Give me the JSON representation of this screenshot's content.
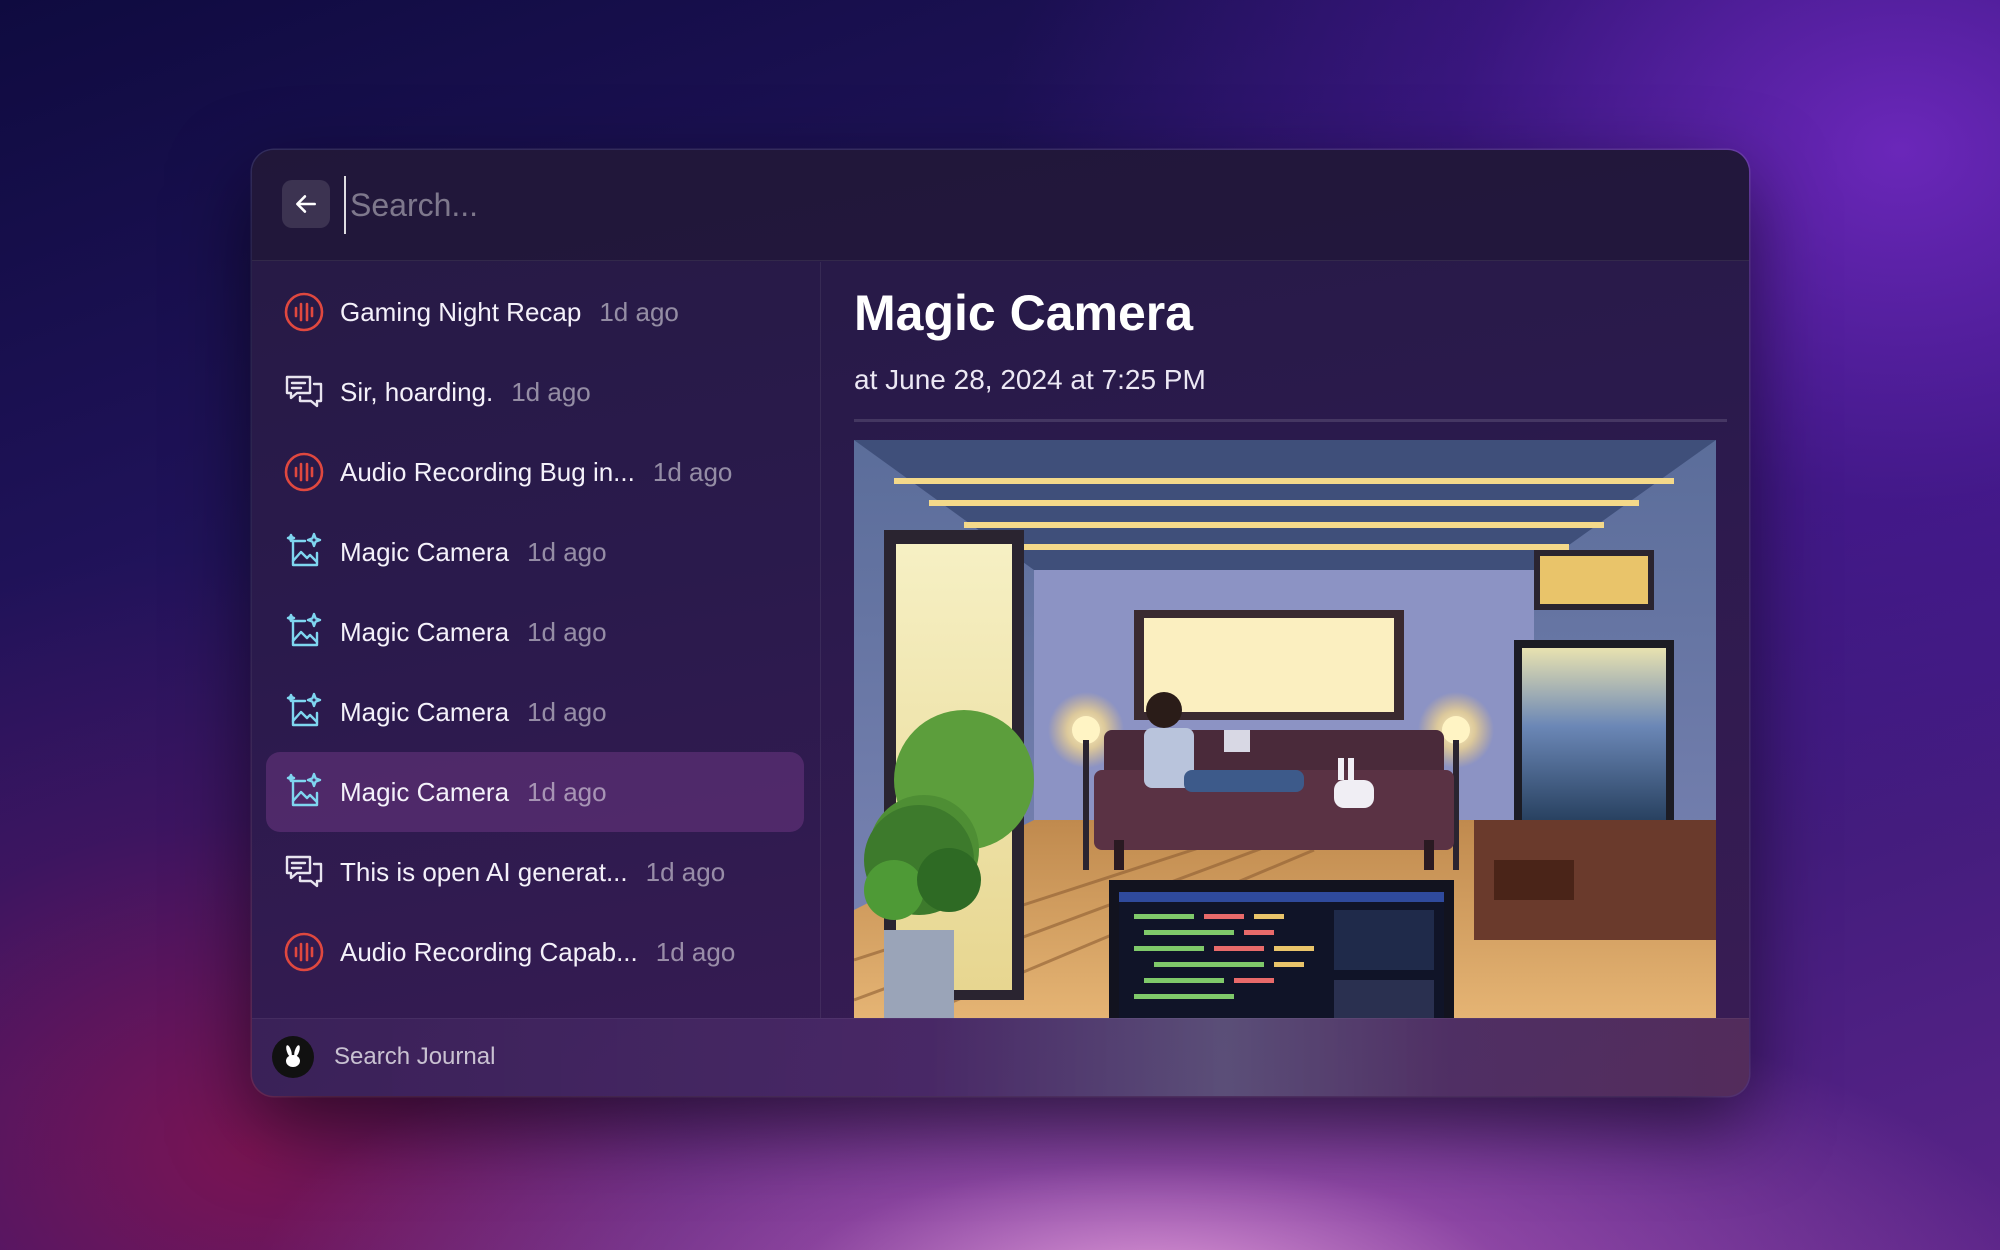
{
  "search": {
    "placeholder": "Search...",
    "value": ""
  },
  "list": {
    "items": [
      {
        "title": "Gaming Night Recap",
        "time": "1d ago",
        "icon": "audio-recording-icon",
        "selected": false
      },
      {
        "title": "Sir, hoarding.",
        "time": "1d ago",
        "icon": "chat-bubbles-icon",
        "selected": false
      },
      {
        "title": "Audio Recording Bug in...",
        "time": "1d ago",
        "icon": "audio-recording-icon",
        "selected": false
      },
      {
        "title": "Magic Camera",
        "time": "1d ago",
        "icon": "magic-image-icon",
        "selected": false
      },
      {
        "title": "Magic Camera",
        "time": "1d ago",
        "icon": "magic-image-icon",
        "selected": false
      },
      {
        "title": "Magic Camera",
        "time": "1d ago",
        "icon": "magic-image-icon",
        "selected": false
      },
      {
        "title": "Magic Camera",
        "time": "1d ago",
        "icon": "magic-image-icon",
        "selected": true
      },
      {
        "title": "This is open AI generat...",
        "time": "1d ago",
        "icon": "chat-bubbles-icon",
        "selected": false
      },
      {
        "title": "Audio Recording Capab...",
        "time": "1d ago",
        "icon": "audio-recording-icon",
        "selected": false
      }
    ]
  },
  "detail": {
    "title": "Magic Camera",
    "date": "at June 28, 2024 at 7:25 PM",
    "image_icon": "pixel-art-living-room-image"
  },
  "footer": {
    "label": "Search Journal",
    "logo_icon": "rabbit-logo-icon"
  },
  "colors": {
    "audio_icon": "#e0483f",
    "magic_icon": "#7fd6f0",
    "chat_icon": "#e8e4ef",
    "selected_row": "#5a2f6e"
  }
}
